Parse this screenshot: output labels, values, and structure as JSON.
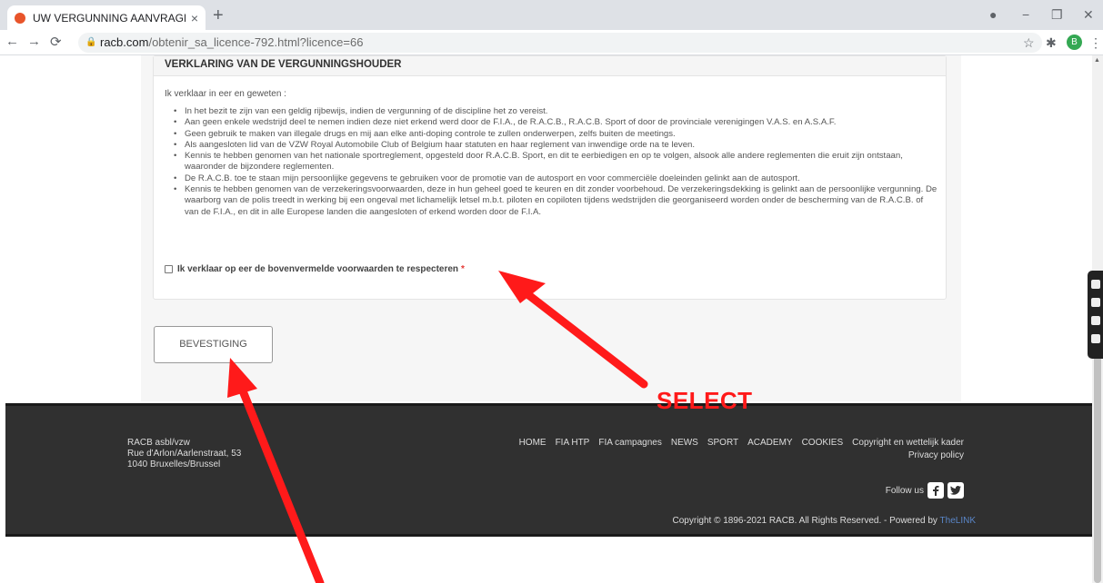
{
  "browser": {
    "tab_title": "UW VERGUNNING AANVRAGEN",
    "tab_close": "×",
    "new_tab": "+",
    "url_host": "racb.com",
    "url_path": "/obtenir_sa_licence-792.html?licence=66",
    "profile_initial": "B"
  },
  "panel": {
    "heading": "VERKLARING VAN DE VERGUNNINGSHOUDER",
    "intro": "Ik verklaar in eer en geweten :",
    "clauses": [
      "In het bezit te zijn van een geldig rijbewijs, indien de vergunning of de discipline het zo vereist.",
      "Aan geen enkele wedstrijd deel te nemen indien deze niet erkend werd door de F.I.A., de R.A.C.B., R.A.C.B. Sport of door de provinciale verenigingen V.A.S. en A.S.A.F.",
      "Geen gebruik te maken van illegale drugs en mij aan elke anti-doping controle te zullen onderwerpen, zelfs buiten de meetings.",
      "Als aangesloten lid van de VZW Royal Automobile Club of Belgium haar statuten en haar reglement van inwendige orde na te leven.",
      "Kennis te hebben genomen van het nationale sportreglement, opgesteld door R.A.C.B. Sport, en dit te eerbiedigen en op te volgen, alsook alle andere reglementen die eruit zijn ontstaan, waaronder de bijzondere reglementen.",
      "De R.A.C.B. toe te staan mijn persoonlijke gegevens te gebruiken voor de promotie van de autosport en voor commerciële doeleinden gelinkt aan de autosport.",
      "Kennis te hebben genomen van de verzekeringsvoorwaarden, deze in hun geheel goed te keuren en dit zonder voorbehoud. De verzekeringsdekking is gelinkt aan de persoonlijke vergunning. De waarborg van de polis treedt in werking bij een ongeval met lichamelijk letsel m.b.t. piloten en copiloten tijdens wedstrijden die georganiseerd worden onder de bescherming van de R.A.C.B. of van de F.I.A., en dit in alle Europese landen die aangesloten of erkend worden door de F.I.A."
    ],
    "checkbox_label": "Ik verklaar op eer de bovenvermelde voorwaarden te respecteren",
    "required_mark": "*"
  },
  "form": {
    "submit_label": "BEVESTIGING"
  },
  "footer": {
    "address": [
      "RACB asbl/vzw",
      "Rue d'Arlon/Aarlenstraat, 53",
      "1040 Bruxelles/Brussel"
    ],
    "nav": [
      "HOME",
      "FIA HTP",
      "FIA campagnes",
      "NEWS",
      "SPORT",
      "ACADEMY",
      "COOKIES",
      "Copyright en wettelijk kader"
    ],
    "privacy": "Privacy policy",
    "follow": "Follow us",
    "copyright": "Copyright © 1896-2021 RACB. All Rights Reserved. - Powered by",
    "powered_link": "TheLINK"
  },
  "annotation": {
    "label": "SELECT",
    "color": "#ff1a1a"
  }
}
